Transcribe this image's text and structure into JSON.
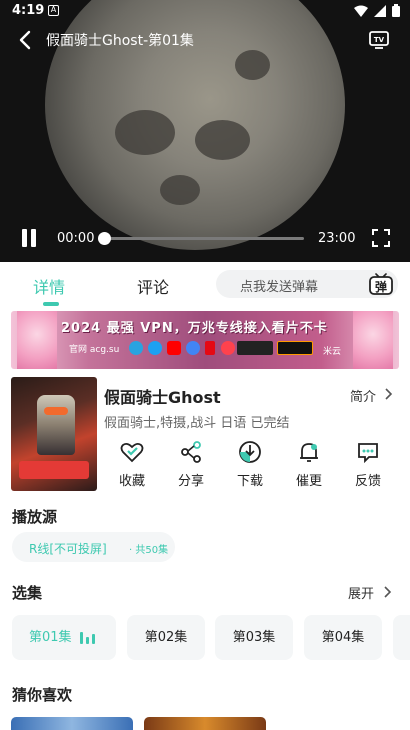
{
  "status_bar": {
    "time": "4:19",
    "app_badge": "A"
  },
  "player": {
    "title": "假面骑士Ghost-第01集",
    "current_time": "00:00",
    "total_time": "23:00",
    "progress": 0.0
  },
  "tabs": [
    {
      "label": "详情",
      "active": true
    },
    {
      "label": "评论",
      "active": false
    }
  ],
  "danmaku": {
    "placeholder": "点我发送弹幕",
    "icon_text": "弹"
  },
  "banner": {
    "headline": "2024 最强 VPN，万兆专线接入看片不卡",
    "site": "官网 acg.su",
    "brand": "米云"
  },
  "show": {
    "title": "假面骑士Ghost",
    "intro_label": "简介",
    "tags": "假面骑士,特摄,战斗 日语 已完结"
  },
  "actions": [
    {
      "label": "收藏",
      "icon": "heart-check-icon"
    },
    {
      "label": "分享",
      "icon": "share-icon"
    },
    {
      "label": "下载",
      "icon": "download-icon"
    },
    {
      "label": "催更",
      "icon": "bell-icon"
    },
    {
      "label": "反馈",
      "icon": "feedback-icon"
    }
  ],
  "source": {
    "section_title": "播放源",
    "name": "R线[不可投屏]",
    "count": "· 共50集"
  },
  "episodes": {
    "section_title": "选集",
    "expand_label": "展开",
    "items": [
      "第01集",
      "第02集",
      "第03集",
      "第04集"
    ],
    "current_index": 0
  },
  "recommend": {
    "section_title": "猜你喜欢"
  },
  "colors": {
    "accent": "#3ec9b0",
    "chip_bg": "#f4f6f7",
    "player_bg": "#121212"
  }
}
